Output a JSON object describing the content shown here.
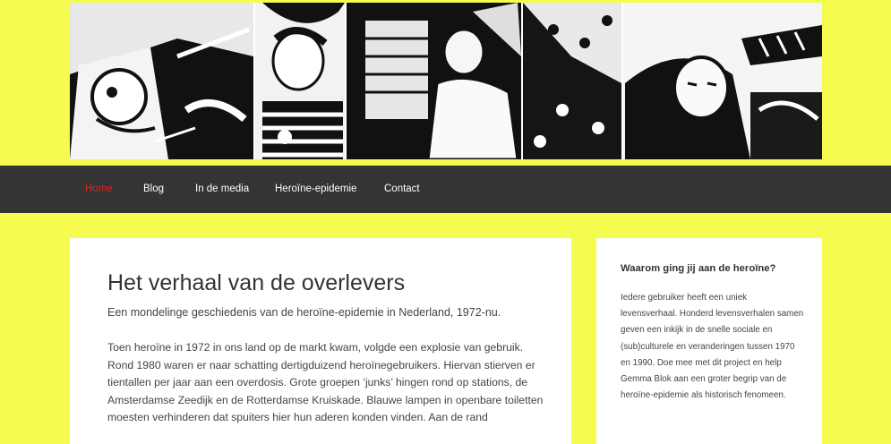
{
  "banner": {
    "alt": "comic illustration banner"
  },
  "nav": {
    "items": [
      {
        "label": "Home",
        "active": true
      },
      {
        "label": "Blog"
      },
      {
        "label": "In de media"
      },
      {
        "label": "Heroïne-epidemie"
      },
      {
        "label": "Contact"
      }
    ]
  },
  "main": {
    "title": "Het verhaal van de overlevers",
    "subtitle": "Een mondelinge geschiedenis van de heroïne-epidemie in Nederland, 1972-nu.",
    "body": "Toen heroïne in 1972 in ons land op de markt kwam, volgde een explosie van gebruik. Rond 1980 waren er naar schatting dertigduizend heroïnegebruikers. Hiervan stierven er tientallen per jaar aan een overdosis. Grote groepen ‘junks’ hingen rond op stations, de Amsterdamse Zeedijk en de Rotterdamse Kruiskade. Blauwe lampen in openbare toiletten moesten verhinderen dat spuiters hier hun aderen konden vinden. Aan de rand"
  },
  "sidebar": {
    "widget_title": "Waarom ging jij aan de heroïne?",
    "widget_text": "Iedere gebruiker heeft een uniek levensverhaal. Honderd levensverhalen samen geven een inkijk in de snelle sociale en (sub)culturele en veranderingen tussen 1970 en 1990. Doe mee met dit project en help Gemma Blok aan een groter begrip van de heroïne-epidemie als historisch fenomeen."
  },
  "colors": {
    "page_bg": "#f5fb4f",
    "nav_bg": "#343434",
    "nav_active": "#e0231f",
    "card_bg": "#ffffff"
  }
}
